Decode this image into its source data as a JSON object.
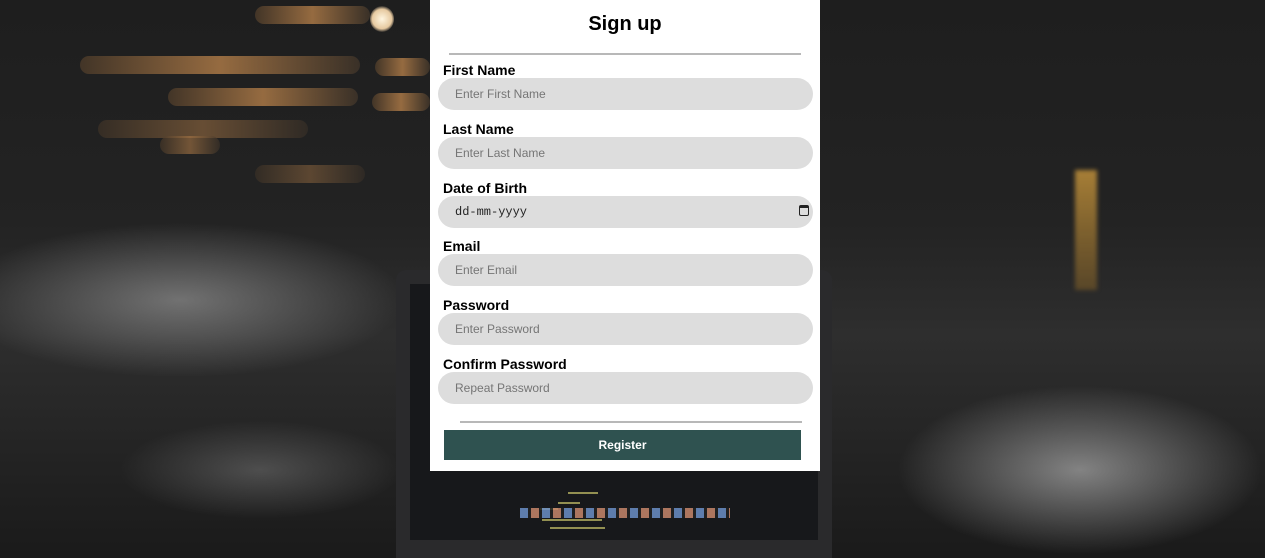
{
  "form": {
    "title": "Sign up",
    "fields": [
      {
        "label": "First Name",
        "placeholder": "Enter First Name",
        "type": "text"
      },
      {
        "label": "Last Name",
        "placeholder": "Enter Last Name",
        "type": "text"
      },
      {
        "label": "Date of Birth",
        "placeholder": "dd-mm-yyyy",
        "type": "date"
      },
      {
        "label": "Email",
        "placeholder": "Enter Email",
        "type": "email"
      },
      {
        "label": "Password",
        "placeholder": "Enter Password",
        "type": "password"
      },
      {
        "label": "Confirm Password",
        "placeholder": "Repeat Password",
        "type": "password"
      }
    ],
    "submit_label": "Register"
  },
  "colors": {
    "panel": "#ffffff",
    "input_bg": "#dddddd",
    "button": "#2f5250",
    "divider": "#b8b8b8"
  },
  "icons": {
    "date_picker": "calendar-icon"
  }
}
